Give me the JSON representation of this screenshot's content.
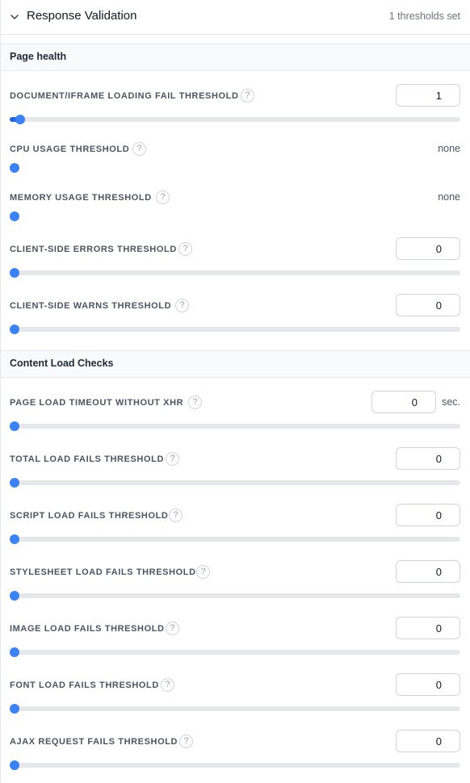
{
  "header": {
    "title": "Response Validation",
    "threshold_count": "1 thresholds set"
  },
  "sections": [
    {
      "title": "Page health",
      "items": [
        {
          "label": "DOCUMENT/IFRAME LOADING FAIL THRESHOLD",
          "value": "1",
          "fraction": 0.02
        },
        {
          "label": "CPU USAGE THRESHOLD",
          "value_text": "none"
        },
        {
          "label": "MEMORY USAGE THRESHOLD",
          "value_text": "none"
        },
        {
          "label": "CLIENT-SIDE ERRORS THRESHOLD",
          "value": "0",
          "fraction": 0
        },
        {
          "label": "CLIENT-SIDE WARNS THRESHOLD",
          "value": "0",
          "fraction": 0
        }
      ]
    },
    {
      "title": "Content Load Checks",
      "items": [
        {
          "label": "PAGE LOAD TIMEOUT WITHOUT XHR",
          "value": "0",
          "unit": "sec.",
          "fraction": 0
        },
        {
          "label": "TOTAL LOAD FAILS THRESHOLD",
          "value": "0",
          "fraction": 0
        },
        {
          "label": "SCRIPT LOAD FAILS THRESHOLD",
          "value": "0",
          "fraction": 0
        },
        {
          "label": "STYLESHEET LOAD FAILS THRESHOLD",
          "value": "0",
          "fraction": 0
        },
        {
          "label": "IMAGE LOAD FAILS THRESHOLD",
          "value": "0",
          "fraction": 0
        },
        {
          "label": "FONT LOAD FAILS THRESHOLD",
          "value": "0",
          "fraction": 0
        },
        {
          "label": "AJAX REQUEST FAILS THRESHOLD",
          "value": "0",
          "fraction": 0
        }
      ]
    }
  ],
  "help_glyph": "?",
  "colors": {
    "accent": "#3b82f6",
    "fill": "#2563eb",
    "track": "#e5e7eb"
  }
}
